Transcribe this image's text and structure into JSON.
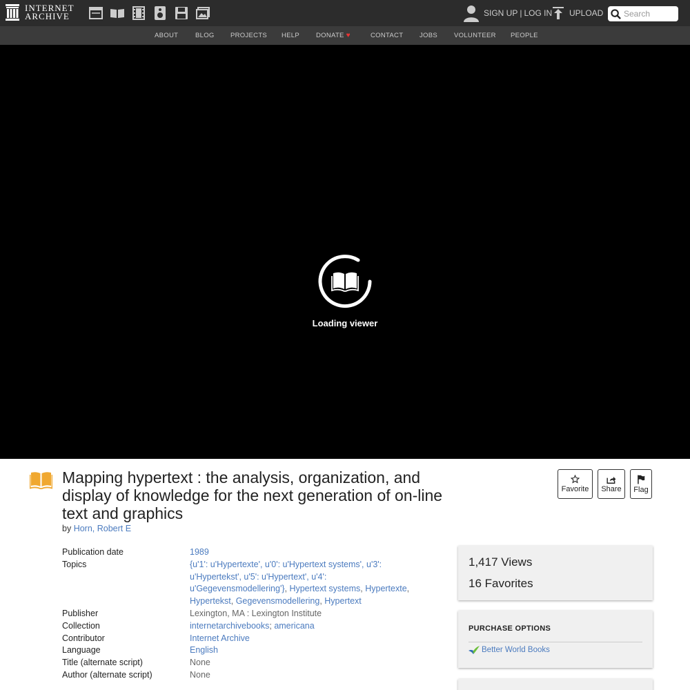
{
  "header": {
    "logo_line1": "INTERNET",
    "logo_line2": "ARCHIVE",
    "media_icons": [
      "web-icon",
      "texts-icon",
      "video-icon",
      "audio-icon",
      "software-icon",
      "images-icon"
    ],
    "signup_label": "SIGN UP",
    "separator": "|",
    "login_label": "LOG IN",
    "upload_label": "UPLOAD",
    "search_placeholder": "Search"
  },
  "subnav": {
    "items": [
      "ABOUT",
      "BLOG",
      "PROJECTS",
      "HELP",
      "DONATE",
      "CONTACT",
      "JOBS",
      "VOLUNTEER",
      "PEOPLE"
    ],
    "donate_heart": "♥"
  },
  "viewer": {
    "loading_text": "Loading viewer"
  },
  "item": {
    "title": "Mapping hypertext : the analysis, organization, and display of knowledge for the next generation of on-line text and graphics",
    "by_label": "by",
    "author": "Horn, Robert E"
  },
  "actions": {
    "favorite": "Favorite",
    "share": "Share",
    "flag": "Flag"
  },
  "metadata": {
    "publication_date_label": "Publication date",
    "publication_date": "1989",
    "topics_label": "Topics",
    "topics_1": "{u'1': u'Hypertexte', u'0': u'Hypertext systems', u'3': u'Hypertekst', u'5': u'Hypertext', u'4': u'Gegevensmodellering'}",
    "topics_2": "Hypertext systems",
    "topics_3": "Hypertexte",
    "topics_4": "Hypertekst",
    "topics_5": "Gegevensmodellering",
    "topics_6": "Hypertext",
    "publisher_label": "Publisher",
    "publisher": "Lexington, MA : Lexington Institute",
    "collection_label": "Collection",
    "collection_1": "internetarchivebooks",
    "collection_2": "americana",
    "contributor_label": "Contributor",
    "contributor": "Internet Archive",
    "language_label": "Language",
    "language": "English",
    "title_alt_label": "Title (alternate script)",
    "title_alt": "None",
    "author_alt_label": "Author (alternate script)",
    "author_alt": "None"
  },
  "stats": {
    "views_count": "1,417",
    "views_label": "Views",
    "favorites_count": "16",
    "favorites_label": "Favorites"
  },
  "purchase": {
    "title": "PURCHASE OPTIONS",
    "vendor": "Better World Books"
  },
  "colors": {
    "topbar": "#2c2c2c",
    "subnav": "#3b3b3b",
    "link": "#4b7bbf",
    "book_icon": "#f0a830",
    "heart": "#ee3333"
  }
}
